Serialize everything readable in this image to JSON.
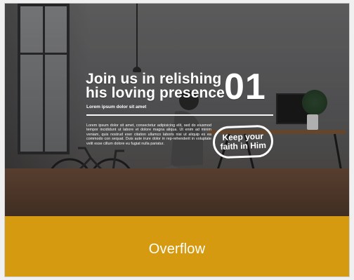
{
  "slide": {
    "headline": {
      "line1": "Join us in relishing",
      "line2": "his loving presence"
    },
    "number": "01",
    "subtitle": "Lorem ipsum dolor sit amet",
    "body": "Lorem ipsum dolor sit amet, consectetur adipisicing elit, sed do eiusmod tempor incididunt ut labore et dolore magna aliqua. Ut enim ad minim veniam, quis nostrud exer citation ullamco laboris nisi ut aliquip ex ea commodo con sequat. Duis aute irure dolor in rep-rehenderit in voluptate velit esse cillum dolore eu fugiat nulla pariatur.",
    "badge": {
      "line1": "Keep your",
      "line2": "faith in Him"
    }
  },
  "brand": {
    "name": "Overflow",
    "bar_color": "#D59A0F"
  }
}
